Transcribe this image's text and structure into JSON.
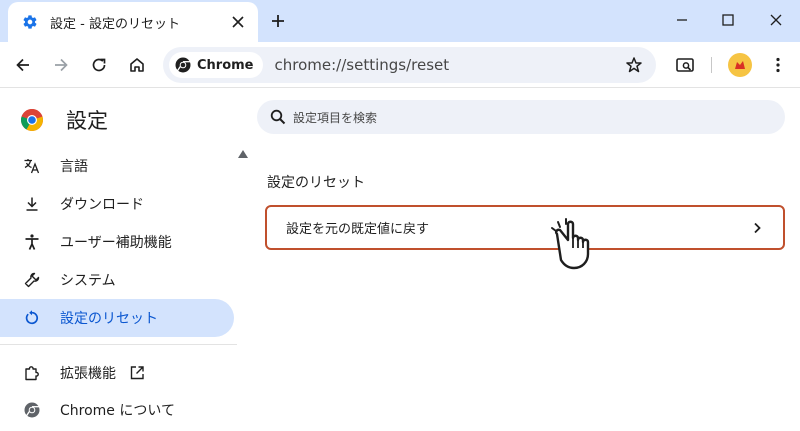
{
  "tab": {
    "title": "設定 - 設定のリセット",
    "favicon": "gear-icon"
  },
  "toolbar": {
    "chip_label": "Chrome",
    "url": "chrome://settings/reset"
  },
  "sidebar": {
    "title": "設定",
    "items": [
      {
        "label": "言語",
        "icon": "translate-icon"
      },
      {
        "label": "ダウンロード",
        "icon": "download-icon"
      },
      {
        "label": "ユーザー補助機能",
        "icon": "accessibility-icon"
      },
      {
        "label": "システム",
        "icon": "wrench-icon"
      },
      {
        "label": "設定のリセット",
        "icon": "reset-icon",
        "active": true
      },
      {
        "label": "拡張機能",
        "icon": "extension-icon"
      },
      {
        "label": "Chrome について",
        "icon": "chrome-icon"
      }
    ]
  },
  "search": {
    "placeholder": "設定項目を検索"
  },
  "main": {
    "section_title": "設定のリセット",
    "row_label": "設定を元の既定値に戻す"
  },
  "colors": {
    "tabstrip": "#d3e3fd",
    "active_nav": "#d3e3fd",
    "accent": "#0b57d0",
    "highlight_border": "#c0502d"
  }
}
